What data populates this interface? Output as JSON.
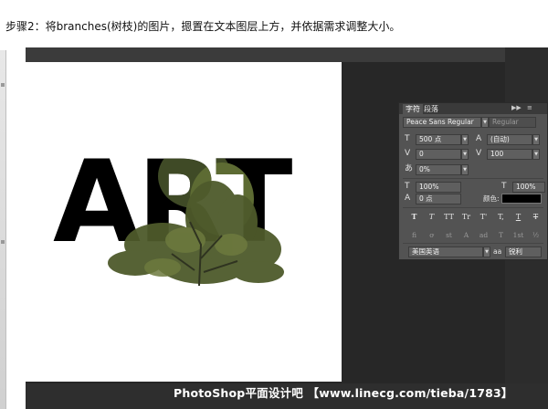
{
  "caption": "步骤2：将branches(树枝)的图片，摁置在文本图层上方，并依据需求调整大小。",
  "canvas": {
    "text": "ART",
    "text_color": "#000000",
    "tree_color": "#4d5a2c"
  },
  "character_panel": {
    "tabs": [
      "字符",
      "段落"
    ],
    "collapse_icon": "double-chevron-right-icon",
    "menu_icon": "panel-menu-icon",
    "font_family": "Peace Sans Regular",
    "font_style": "Regular",
    "font_size": "500 点",
    "leading": "(自动)",
    "kerning": "0",
    "tracking": "100",
    "tsume": "0%",
    "vertical_scale": "100%",
    "horizontal_scale": "100%",
    "baseline_shift": "0 点",
    "color_label": "颜色:",
    "color_value": "#000000",
    "style_buttons": [
      "T",
      "T",
      "TT",
      "Tr",
      "T'",
      "T,",
      "T",
      "T"
    ],
    "ligature_buttons": [
      "fi",
      "ơ",
      "st",
      "A",
      "ad",
      "T",
      "1st",
      "½"
    ],
    "language": "美国英语",
    "aa_label": "aa",
    "antialias": "锐利"
  },
  "watermark": "PhotoShop平面设计吧 【www.linecg.com/tieba/1783】"
}
